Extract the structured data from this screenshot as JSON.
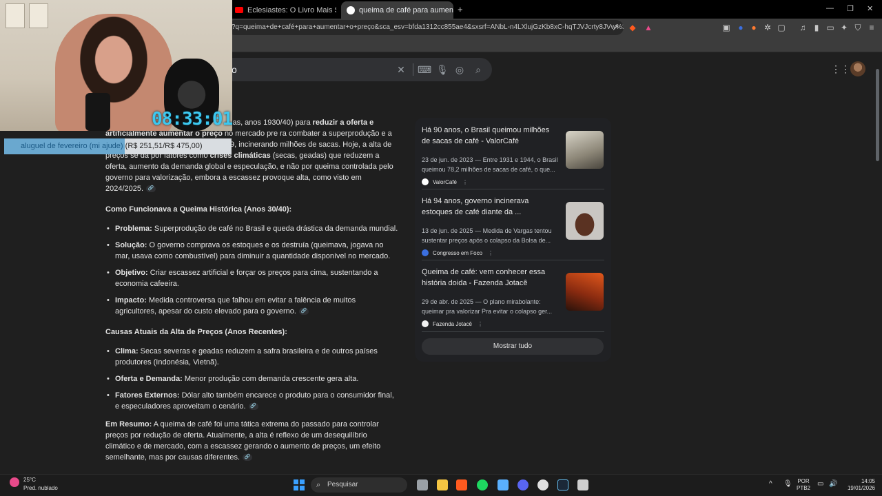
{
  "browser": {
    "tabs": [
      {
        "title": "Eclesiastes: O Livro Mais Sombrio da",
        "fav": "#ff0000"
      },
      {
        "title": "queima de café para aumentar o",
        "fav": "#ffffff",
        "active": true
      }
    ],
    "new_tab": "+",
    "url": "?q=queima+de+café+para+aumentar+o+preço&sca_esv=bfda1312cc855ae4&sxsrf=ANbL-n4LXlujGzKb8xC-hqTJVJcrty8JVw%3A...",
    "window_controls": {
      "minimize": "—",
      "restore": "❐",
      "close": "✕"
    }
  },
  "search": {
    "query_tail": "o",
    "icons": [
      "clear-icon",
      "keyboard-icon",
      "mic-icon",
      "lens-icon",
      "search-icon"
    ]
  },
  "main": {
    "intro_part1": "ca do governo brasileiro (Getúlio Vargas, anos 1930/40) para ",
    "intro_bold": "reduzir a oferta e artificialmente aumentar o preço",
    "intro_part2": " no mercado",
    "intro_line3a": "pre",
    "intro_line3b": "ra combater a superprodução e a queda de",
    "intro_line4": "preços após a crise de 1929, incinerando milhões de sacas. Hoje, a alta de preços se dá por fatores como ",
    "intro_bold2": "crises climáticas",
    "intro_rest": " (secas, geadas) que reduzem a oferta, aumento da demanda global e especulação, e não por queima controlada pelo governo para valorização, embora a escassez provoque alta, como visto em 2024/2025.",
    "h1": "Como Funcionava a Queima Histórica (Anos 30/40):",
    "list1": [
      {
        "k": "Problema:",
        "v": " Superprodução de café no Brasil e queda drástica da demanda mundial."
      },
      {
        "k": "Solução:",
        "v": " O governo comprava os estoques e os destruía (queimava, jogava no mar, usava como combustível) para diminuir a quantidade disponível no mercado."
      },
      {
        "k": "Objetivo:",
        "v": " Criar escassez artificial e forçar os preços para cima, sustentando a economia cafeeira."
      },
      {
        "k": "Impacto:",
        "v": " Medida controversa que falhou em evitar a falência de muitos agricultores, apesar do custo elevado para o governo."
      }
    ],
    "h2": "Causas Atuais da Alta de Preços (Anos Recentes):",
    "list2": [
      {
        "k": "Clima:",
        "v": " Secas severas e geadas reduzem a safra brasileira e de outros países produtores (Indonésia, Vietnã)."
      },
      {
        "k": "Oferta e Demanda:",
        "v": " Menor produção com demanda crescente gera alta."
      },
      {
        "k": "Fatores Externos:",
        "v": " Dólar alto também encarece o produto para o consumidor final, e especuladores aproveitam o cenário."
      }
    ],
    "summary_k": "Em Resumo:",
    "summary_v": " A queima de café foi uma tática extrema do passado para controlar preços por redução de oferta. Atualmente, a alta é reflexo de um desequilíbrio climático e de mercado, com a escassez gerando o aumento de preços, um efeito semelhante, mas por causas diferentes.",
    "chip": "🔗"
  },
  "side": {
    "cards": [
      {
        "title": "Há 90 anos, o Brasil queimou milhões de sacas de café - ValorCafé",
        "snippet": "23 de jun. de 2023 — Entre 1931 e 1944, o Brasil queimou 78,2 milhões de sacas de café, o que...",
        "source": "ValorCafé",
        "dot": "#ffffff",
        "thumb": "linear-gradient(160deg,#d8d4c8,#8c8677 60%,#4a463e)"
      },
      {
        "title": "Há 94 anos, governo incinerava estoques de café diante da ...",
        "snippet": "13 de jun. de 2025 — Medida de Vargas tentou sustentar preços após o colapso da Bolsa de...",
        "source": "Congresso em Foco",
        "dot": "#3b6fe0",
        "thumb": "radial-gradient(ellipse at 50% 60%,#5a3222 0 35%,#c9c6c2 36% 100%)"
      },
      {
        "title": "Queima de café: vem conhecer essa história doida - Fazenda Jotacê",
        "snippet": "29 de abr. de 2025 — O plano mirabolante: queimar pra valorizar Pra evitar o colapso ger...",
        "source": "Fazenda Jotacê",
        "dot": "#f1f1f1",
        "thumb": "linear-gradient(200deg,#e0581c,#8a2b10 55%,#2a120a)"
      }
    ],
    "kebab": "⋮",
    "show_all": "Mostrar tudo"
  },
  "overlay": {
    "timer": "08:33:01",
    "goal_label": "aluguel de fevereiro (mi ajude)",
    "goal_amount": "(R$ 251,51/R$ 475,00)",
    "goal_progress": 0.53
  },
  "taskbar": {
    "temp": "25°C",
    "condition": "Pred. nublado",
    "search": "Pesquisar",
    "lang1": "POR",
    "lang2": "PTB2",
    "time": "14:05",
    "date": "19/01/2026"
  },
  "colors": {
    "accent_timer": "#3cc8f0",
    "link_chip": "#303134",
    "panel": "#202124"
  }
}
